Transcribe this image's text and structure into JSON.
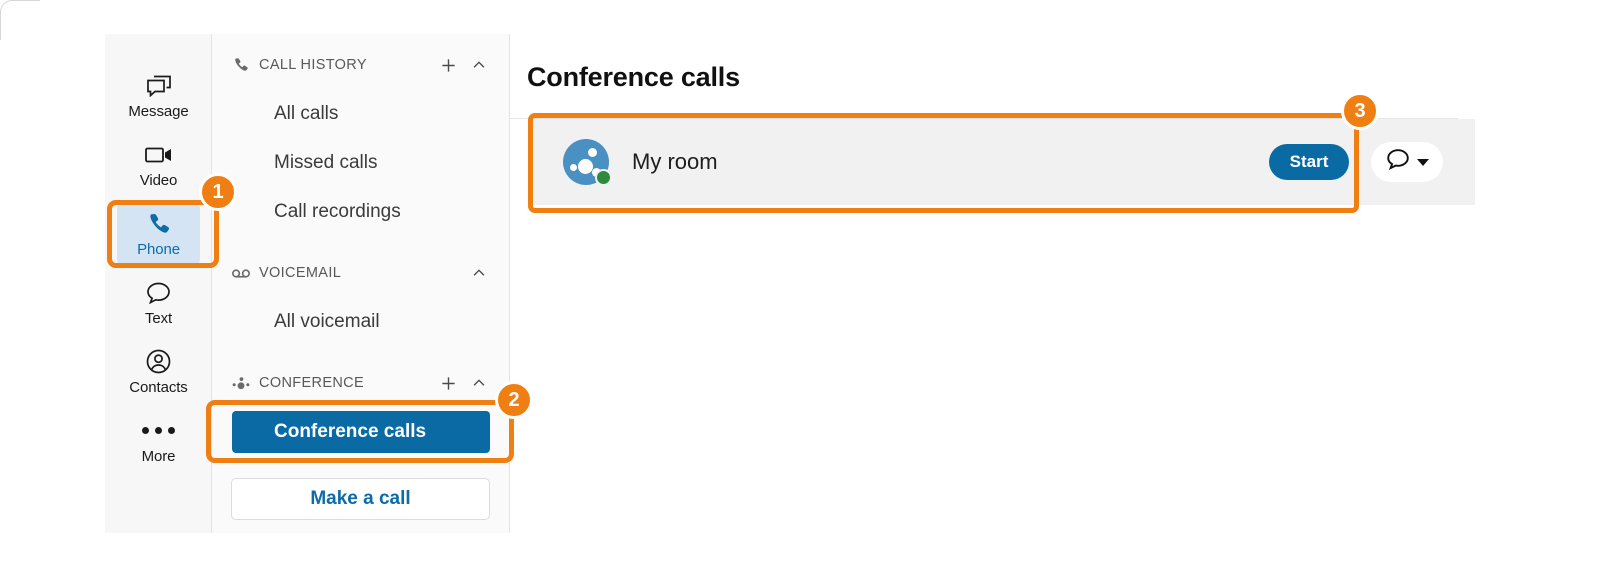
{
  "rail": {
    "items": [
      {
        "label": "Message",
        "icon": "message-icon",
        "active": false
      },
      {
        "label": "Video",
        "icon": "video-icon",
        "active": false
      },
      {
        "label": "Phone",
        "icon": "phone-icon",
        "active": true
      },
      {
        "label": "Text",
        "icon": "text-icon",
        "active": false
      },
      {
        "label": "Contacts",
        "icon": "contacts-icon",
        "active": false
      },
      {
        "label": "More",
        "icon": "more-icon",
        "active": false
      }
    ]
  },
  "nav": {
    "sections": [
      {
        "title": "CALL HISTORY",
        "icon": "phone-handset-icon",
        "add_button": "+",
        "collapse_button": "chevron-up-icon",
        "items": [
          {
            "label": "All calls",
            "selected": false
          },
          {
            "label": "Missed calls",
            "selected": false
          },
          {
            "label": "Call recordings",
            "selected": false
          }
        ]
      },
      {
        "title": "VOICEMAIL",
        "icon": "voicemail-icon",
        "add_button": "",
        "collapse_button": "chevron-up-icon",
        "items": [
          {
            "label": "All voicemail",
            "selected": false
          }
        ]
      },
      {
        "title": "CONFERENCE",
        "icon": "conference-icon",
        "add_button": "+",
        "collapse_button": "chevron-up-icon",
        "items": [
          {
            "label": "Conference calls",
            "selected": true
          }
        ]
      }
    ],
    "make_call_label": "Make a call"
  },
  "main": {
    "title": "Conference calls",
    "rooms": [
      {
        "name": "My room",
        "avatar_icon": "conference-room-avatar",
        "presence": "available",
        "start_label": "Start",
        "chat_icon": "chat-bubble-icon",
        "chat_caret": "caret-down-icon"
      }
    ]
  },
  "annotations": {
    "badges": [
      {
        "number": "1",
        "target": "phone-rail-item"
      },
      {
        "number": "2",
        "target": "conference-calls-nav-item"
      },
      {
        "number": "3",
        "target": "my-room-row"
      }
    ],
    "highlight_color": "#f07f13"
  }
}
